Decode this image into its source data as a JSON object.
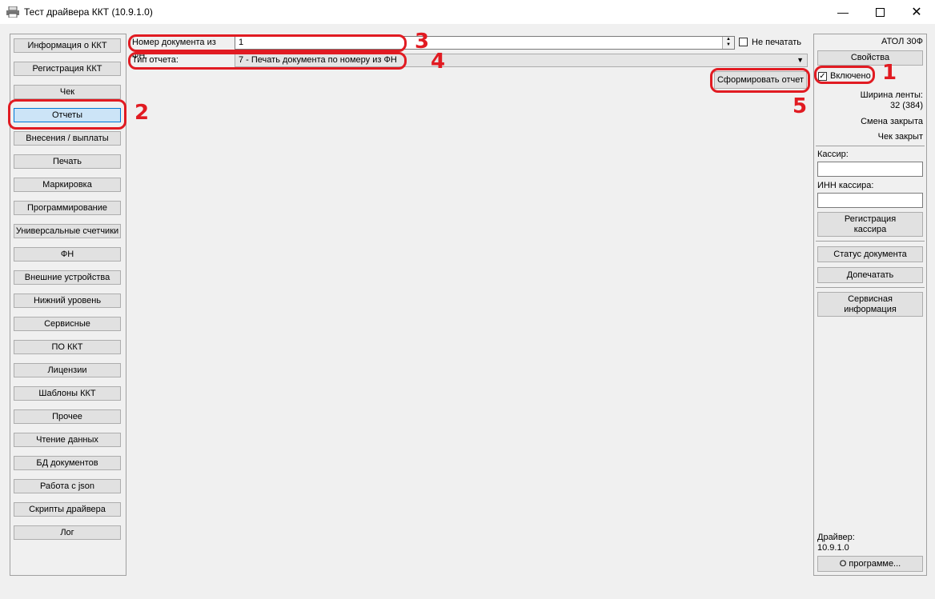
{
  "window": {
    "title": "Тест драйвера ККТ (10.9.1.0)",
    "min_icon": "minimize-icon",
    "max_icon": "maximize-icon",
    "close_icon": "close-icon"
  },
  "nav": {
    "items": [
      "Информация о ККТ",
      "Регистрация ККТ",
      "Чек",
      "Отчеты",
      "Внесения / выплаты",
      "Печать",
      "Маркировка",
      "Программирование",
      "Универсальные счетчики",
      "ФН",
      "Внешние устройства",
      "Нижний уровень",
      "Сервисные",
      "ПО ККТ",
      "Лицензии",
      "Шаблоны ККТ",
      "Прочее",
      "Чтение данных",
      "БД документов",
      "Работа с json",
      "Скрипты драйвера",
      "Лог"
    ],
    "active_index": 3
  },
  "form": {
    "doc_number_label": "Номер документа из ФН:",
    "doc_number_value": "1",
    "no_print_label": "Не печатать",
    "no_print_checked": false,
    "report_type_label": "Тип отчета:",
    "report_type_value": "7 - Печать документа по номеру из ФН",
    "generate_button": "Сформировать отчет"
  },
  "right": {
    "device": "АТОЛ 30Ф",
    "properties_button": "Свойства",
    "enabled_label": "Включено",
    "enabled_checked": true,
    "tape_width_label": "Ширина ленты:",
    "tape_width_value": "32 (384)",
    "shift_status": "Смена закрыта",
    "receipt_status": "Чек закрыт",
    "cashier_label": "Кассир:",
    "cashier_value": "",
    "cashier_inn_label": "ИНН кассира:",
    "cashier_inn_value": "",
    "register_cashier_button": "Регистрация кассира",
    "doc_status_button": "Статус документа",
    "reprint_button": "Допечатать",
    "service_info_button": "Сервисная информация",
    "driver_label": "Драйвер:",
    "driver_version": "10.9.1.0",
    "about_button": "О программе..."
  },
  "annotations": {
    "marks": [
      "1",
      "2",
      "3",
      "4",
      "5"
    ],
    "color": "#e11b22"
  }
}
